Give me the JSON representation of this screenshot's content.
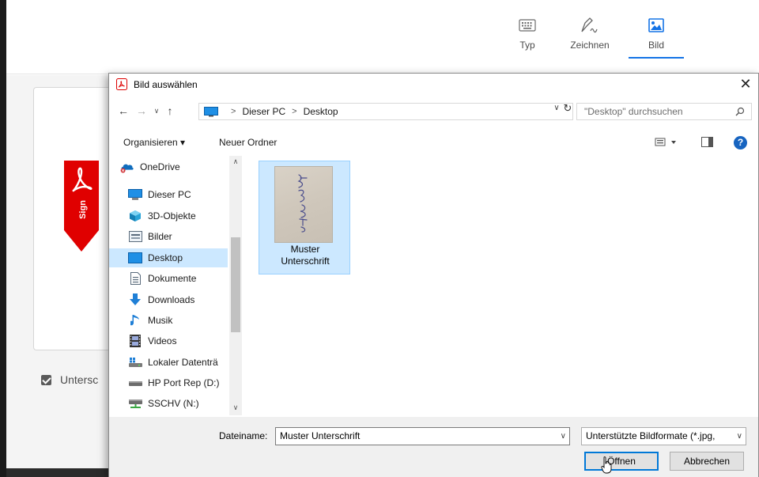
{
  "background": {
    "mode_tabs": [
      {
        "label": "Typ",
        "icon": "keyboard-icon",
        "active": false
      },
      {
        "label": "Zeichnen",
        "icon": "pen-icon",
        "active": false
      },
      {
        "label": "Bild",
        "icon": "image-icon",
        "active": true
      }
    ],
    "sign_ribbon_text": "Sign",
    "save_checkbox_label": "Untersc",
    "accent_color": "#1473e6",
    "ribbon_color": "#e00000"
  },
  "dialog": {
    "title": "Bild auswählen",
    "close_glyph": "✕",
    "address": {
      "crumbs": [
        "Dieser PC",
        "Desktop"
      ],
      "separator": ">"
    },
    "search_placeholder": "\"Desktop\" durchsuchen",
    "toolbar": {
      "organise_label": "Organisieren ▾",
      "new_folder_label": "Neuer Ordner",
      "help_glyph": "?"
    },
    "nav_items": [
      {
        "label": "OneDrive",
        "icon": "onedrive-icon",
        "selected": false
      },
      {
        "label": "Dieser PC",
        "icon": "computer-icon",
        "selected": false
      },
      {
        "label": "3D-Objekte",
        "icon": "3d-objects-icon",
        "selected": false
      },
      {
        "label": "Bilder",
        "icon": "pictures-icon",
        "selected": false
      },
      {
        "label": "Desktop",
        "icon": "desktop-icon",
        "selected": true
      },
      {
        "label": "Dokumente",
        "icon": "documents-icon",
        "selected": false
      },
      {
        "label": "Downloads",
        "icon": "downloads-icon",
        "selected": false
      },
      {
        "label": "Musik",
        "icon": "music-icon",
        "selected": false
      },
      {
        "label": "Videos",
        "icon": "videos-icon",
        "selected": false
      },
      {
        "label": "Lokaler Datenträ",
        "icon": "local-disk-icon",
        "selected": false
      },
      {
        "label": "HP Port Rep (D:)",
        "icon": "drive-icon",
        "selected": false
      },
      {
        "label": "SSCHV (N:)",
        "icon": "network-drive-icon",
        "selected": false
      }
    ],
    "files": [
      {
        "name_line1": "Muster",
        "name_line2": "Unterschrift",
        "selected": true
      }
    ],
    "filename_label": "Dateiname:",
    "filename_value": "Muster Unterschrift",
    "filetype_value": "Unterstützte Bildformate (*.jpg, ",
    "open_button": "Öffnen",
    "cancel_button": "Abbrechen"
  }
}
